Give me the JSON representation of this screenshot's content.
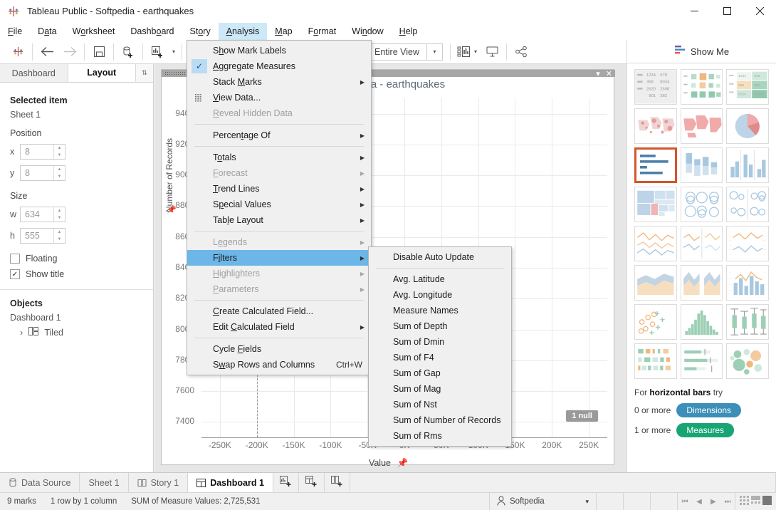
{
  "window": {
    "title": "Tableau Public - Softpedia - earthquakes",
    "app_icon": "tableau-logo-icon",
    "minimize_label": "—",
    "maximize_label": "☐",
    "close_label": "✕"
  },
  "menubar": {
    "items": [
      {
        "label": "File",
        "accel_index": 0,
        "active": false
      },
      {
        "label": "Data",
        "accel_index": 1,
        "active": false
      },
      {
        "label": "Worksheet",
        "accel_index": 1,
        "active": false
      },
      {
        "label": "Dashboard",
        "accel_index": 5,
        "active": false
      },
      {
        "label": "Story",
        "accel_index": 2,
        "active": false
      },
      {
        "label": "Analysis",
        "accel_index": 0,
        "active": true
      },
      {
        "label": "Map",
        "accel_index": 0,
        "active": false
      },
      {
        "label": "Format",
        "accel_index": 1,
        "active": false
      },
      {
        "label": "Window",
        "accel_index": 2,
        "active": false
      },
      {
        "label": "Help",
        "accel_index": 0,
        "active": false
      }
    ]
  },
  "toolbar": {
    "logo": "tableau-logo-icon",
    "back": "back-arrow-icon",
    "forward": "forward-arrow-icon",
    "save": "save-icon",
    "new_data_source": "new-data-source-icon",
    "new_worksheet": "new-worksheet-icon",
    "text_tool": "text-mark-icon",
    "clear_sheet": "clear-sheet-icon",
    "fit_label": "Entire View",
    "fit_arrow": "▾",
    "highlight": "highlight-icon",
    "presentation": "presentation-mode-icon",
    "share": "share-icon"
  },
  "left_panel": {
    "tabs": [
      {
        "label": "Dashboard",
        "selected": false
      },
      {
        "label": "Layout",
        "selected": true
      }
    ],
    "resize_icon": "resize-handle-icon",
    "selected_item_heading": "Selected item",
    "selected_item_name": "Sheet 1",
    "position_heading": "Position",
    "position": [
      {
        "label": "x",
        "value": "8"
      },
      {
        "label": "y",
        "value": "8"
      }
    ],
    "size_heading": "Size",
    "size": [
      {
        "label": "w",
        "value": "634"
      },
      {
        "label": "h",
        "value": "555"
      }
    ],
    "floating_label": "Floating",
    "floating_checked": false,
    "show_title_label": "Show title",
    "show_title_checked": true,
    "objects_heading": "Objects",
    "objects_root": "Dashboard 1",
    "objects_child": "Tiled",
    "objects_expander": "›",
    "objects_child_icon": "tiled-layout-icon"
  },
  "canvas": {
    "sheet_title": "Softpedia - earthquakes",
    "dropdown_caret": "▾",
    "close_icon": "✕",
    "y_axis_label": "Number of Records",
    "y_axis_pin": "pin-icon",
    "y_ticks": [
      "9400",
      "9200",
      "9000",
      "8800",
      "8600",
      "8400",
      "8200",
      "8000",
      "7800",
      "7600",
      "7400"
    ],
    "x_ticks": [
      "-250K",
      "-200K",
      "-150K",
      "-100K",
      "-50K",
      "0K",
      "50K",
      "100K",
      "150K",
      "200K",
      "250K"
    ],
    "x_axis_label": "Value",
    "x_axis_pin": "pin-icon",
    "null_badge": "1 null"
  },
  "chart_data": {
    "type": "scatter",
    "title": "Softpedia - earthquakes",
    "xlabel": "Value",
    "ylabel": "Number of Records",
    "xlim": [
      -275000,
      275000
    ],
    "ylim": [
      7300,
      9500
    ],
    "x_tick_values": [
      -250000,
      -200000,
      -150000,
      -100000,
      -50000,
      0,
      50000,
      100000,
      150000,
      200000,
      250000
    ],
    "x_tick_labels": [
      "-250K",
      "-200K",
      "-150K",
      "-100K",
      "-50K",
      "0K",
      "50K",
      "100K",
      "150K",
      "200K",
      "250K"
    ],
    "y_tick_values": [
      9400,
      9200,
      9000,
      8800,
      8600,
      8400,
      8200,
      8000,
      7800,
      7600,
      7400
    ],
    "y_tick_labels": [
      "9400",
      "9200",
      "9000",
      "8800",
      "8600",
      "8400",
      "8200",
      "8000",
      "7800",
      "7600",
      "7400"
    ],
    "grid": true,
    "legend": "none",
    "annotations": [
      "1 null"
    ],
    "points": [],
    "reference_line": {
      "x": -200000,
      "style": "dashed",
      "color": "#9a9a9a"
    },
    "marks_count": 9,
    "summary": "SUM of Measure Values: 2,725,531"
  },
  "show_me": {
    "tab_label": "Show Me",
    "tab_icon": "show-me-icon",
    "thumbnails": [
      {
        "name": "text-table"
      },
      {
        "name": "heat-map"
      },
      {
        "name": "highlight-table"
      },
      {
        "name": "symbol-map"
      },
      {
        "name": "filled-map"
      },
      {
        "name": "pie-chart"
      },
      {
        "name": "horizontal-bars",
        "selected": true
      },
      {
        "name": "stacked-bars"
      },
      {
        "name": "side-by-side-bars"
      },
      {
        "name": "treemap"
      },
      {
        "name": "circle-views"
      },
      {
        "name": "side-by-side-circles"
      },
      {
        "name": "continuous-lines"
      },
      {
        "name": "discrete-lines"
      },
      {
        "name": "dual-lines"
      },
      {
        "name": "area-charts-continuous"
      },
      {
        "name": "area-charts-discrete"
      },
      {
        "name": "dual-combination"
      },
      {
        "name": "scatter-plot"
      },
      {
        "name": "histogram"
      },
      {
        "name": "box-and-whisker"
      },
      {
        "name": "gantt"
      },
      {
        "name": "bullet-graph"
      },
      {
        "name": "packed-bubbles"
      }
    ],
    "try_prefix": "For",
    "try_name": "horizontal bars",
    "try_suffix": "try",
    "rules": [
      {
        "count": "0 or more",
        "pill": "Dimensions",
        "color": "#3c8fb8"
      },
      {
        "count": "1 or more",
        "pill": "Measures",
        "color": "#17a673"
      }
    ]
  },
  "bottom_tabs": [
    {
      "label": "Data Source",
      "icon": "data-source-icon",
      "selected": false
    },
    {
      "label": "Sheet 1",
      "icon": "",
      "selected": false
    },
    {
      "label": "Story 1",
      "icon": "story-icon",
      "selected": false
    },
    {
      "label": "Dashboard 1",
      "icon": "dashboard-icon",
      "selected": true
    }
  ],
  "bottom_new_buttons": [
    {
      "name": "new-worksheet-button",
      "icon": "new-worksheet-icon"
    },
    {
      "name": "new-dashboard-button",
      "icon": "new-dashboard-icon"
    },
    {
      "name": "new-story-button",
      "icon": "new-story-icon"
    }
  ],
  "status": {
    "marks": "9 marks",
    "rows_cols": "1 row by 1 column",
    "sum": "SUM of Measure Values: 2,725,531",
    "user": "Softpedia",
    "user_icon": "user-icon",
    "user_caret": "▾",
    "nav": [
      "⏮",
      "◀",
      "▶",
      "⏭"
    ],
    "views": [
      "grid-view-icon",
      "half-view-icon",
      "full-view-icon"
    ]
  },
  "analysis_menu": {
    "items": [
      {
        "label": "Show Mark Labels",
        "accel_index": 1,
        "type": "item"
      },
      {
        "label": "Aggregate Measures",
        "accel_index": 0,
        "type": "item",
        "checked": true
      },
      {
        "label": "Stack Marks",
        "accel_index": 6,
        "type": "submenu"
      },
      {
        "label": "View Data...",
        "accel_index": 0,
        "type": "item",
        "icon": "view-data-icon"
      },
      {
        "label": "Reveal Hidden Data",
        "accel_index": 0,
        "type": "item",
        "disabled": true
      },
      {
        "type": "separator"
      },
      {
        "label": "Percentage Of",
        "accel_index": 6,
        "type": "submenu"
      },
      {
        "type": "separator"
      },
      {
        "label": "Totals",
        "accel_index": 1,
        "type": "submenu"
      },
      {
        "label": "Forecast",
        "accel_index": 0,
        "type": "submenu",
        "disabled": true
      },
      {
        "label": "Trend Lines",
        "accel_index": 0,
        "type": "submenu"
      },
      {
        "label": "Special Values",
        "accel_index": 1,
        "type": "submenu"
      },
      {
        "label": "Table Layout",
        "accel_index": 3,
        "type": "submenu"
      },
      {
        "type": "separator"
      },
      {
        "label": "Legends",
        "accel_index": 1,
        "type": "submenu",
        "disabled": true
      },
      {
        "label": "Filters",
        "accel_index": 1,
        "type": "submenu",
        "highlighted": true
      },
      {
        "label": "Highlighters",
        "accel_index": 0,
        "type": "submenu",
        "disabled": true
      },
      {
        "label": "Parameters",
        "accel_index": 0,
        "type": "submenu",
        "disabled": true
      },
      {
        "type": "separator"
      },
      {
        "label": "Create Calculated Field...",
        "accel_index": 0,
        "type": "item"
      },
      {
        "label": "Edit Calculated Field",
        "accel_index": 5,
        "type": "submenu"
      },
      {
        "type": "separator"
      },
      {
        "label": "Cycle Fields",
        "accel_index": 6,
        "type": "item"
      },
      {
        "label": "Swap Rows and Columns",
        "accel_index": 1,
        "type": "item",
        "shortcut": "Ctrl+W"
      }
    ]
  },
  "filters_submenu": {
    "items": [
      {
        "label": "Disable Auto Update",
        "type": "item"
      },
      {
        "type": "separator"
      },
      {
        "label": "Avg. Latitude",
        "type": "item"
      },
      {
        "label": "Avg. Longitude",
        "type": "item"
      },
      {
        "label": "Measure Names",
        "type": "item"
      },
      {
        "label": "Sum of Depth",
        "type": "item"
      },
      {
        "label": "Sum of Dmin",
        "type": "item"
      },
      {
        "label": "Sum of F4",
        "type": "item"
      },
      {
        "label": "Sum of Gap",
        "type": "item"
      },
      {
        "label": "Sum of Mag",
        "type": "item"
      },
      {
        "label": "Sum of Nst",
        "type": "item"
      },
      {
        "label": "Sum of Number of Records",
        "type": "item"
      },
      {
        "label": "Sum of Rms",
        "type": "item"
      }
    ]
  },
  "watermarks": [
    "SOFTPEDIA",
    "SOFTPEDIA"
  ]
}
